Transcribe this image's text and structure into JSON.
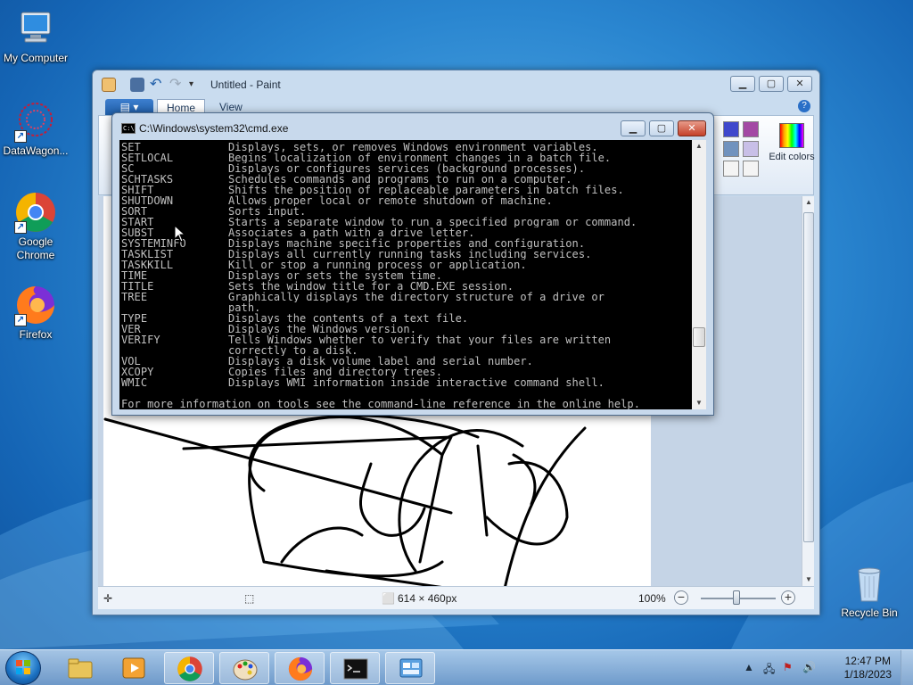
{
  "desktop": {
    "icons": [
      {
        "label": "My Computer"
      },
      {
        "label": "DataWagon..."
      },
      {
        "label": "Google Chrome"
      },
      {
        "label": "Firefox"
      },
      {
        "label": "Recycle Bin"
      }
    ]
  },
  "paint": {
    "title": "Untitled - Paint",
    "tabs": {
      "home": "Home",
      "view": "View"
    },
    "edit_colors": "Edit colors",
    "status": {
      "size": "614 × 460px",
      "zoom": "100%"
    },
    "zoom_level": 1.0
  },
  "cmd": {
    "title": "C:\\Windows\\system32\\cmd.exe",
    "lines": [
      {
        "cmd": "SET",
        "desc": "Displays, sets, or removes Windows environment variables."
      },
      {
        "cmd": "SETLOCAL",
        "desc": "Begins localization of environment changes in a batch file."
      },
      {
        "cmd": "SC",
        "desc": "Displays or configures services (background processes)."
      },
      {
        "cmd": "SCHTASKS",
        "desc": "Schedules commands and programs to run on a computer."
      },
      {
        "cmd": "SHIFT",
        "desc": "Shifts the position of replaceable parameters in batch files."
      },
      {
        "cmd": "SHUTDOWN",
        "desc": "Allows proper local or remote shutdown of machine."
      },
      {
        "cmd": "SORT",
        "desc": "Sorts input."
      },
      {
        "cmd": "START",
        "desc": "Starts a separate window to run a specified program or command."
      },
      {
        "cmd": "SUBST",
        "desc": "Associates a path with a drive letter."
      },
      {
        "cmd": "SYSTEMINFO",
        "desc": "Displays machine specific properties and configuration."
      },
      {
        "cmd": "TASKLIST",
        "desc": "Displays all currently running tasks including services."
      },
      {
        "cmd": "TASKKILL",
        "desc": "Kill or stop a running process or application."
      },
      {
        "cmd": "TIME",
        "desc": "Displays or sets the system time."
      },
      {
        "cmd": "TITLE",
        "desc": "Sets the window title for a CMD.EXE session."
      },
      {
        "cmd": "TREE",
        "desc": "Graphically displays the directory structure of a drive or"
      },
      {
        "cmd": "",
        "desc": "path."
      },
      {
        "cmd": "TYPE",
        "desc": "Displays the contents of a text file."
      },
      {
        "cmd": "VER",
        "desc": "Displays the Windows version."
      },
      {
        "cmd": "VERIFY",
        "desc": "Tells Windows whether to verify that your files are written"
      },
      {
        "cmd": "",
        "desc": "correctly to a disk."
      },
      {
        "cmd": "VOL",
        "desc": "Displays a disk volume label and serial number."
      },
      {
        "cmd": "XCOPY",
        "desc": "Copies files and directory trees."
      },
      {
        "cmd": "WMIC",
        "desc": "Displays WMI information inside interactive command shell."
      }
    ],
    "footer": "For more information on tools see the command-line reference in the online help."
  },
  "taskbar": {
    "clock_time": "12:47 PM",
    "clock_date": "1/18/2023"
  },
  "colors": {
    "accent": "#1f5ea8",
    "console_bg": "#000000",
    "console_fg": "#c0c0c0"
  }
}
